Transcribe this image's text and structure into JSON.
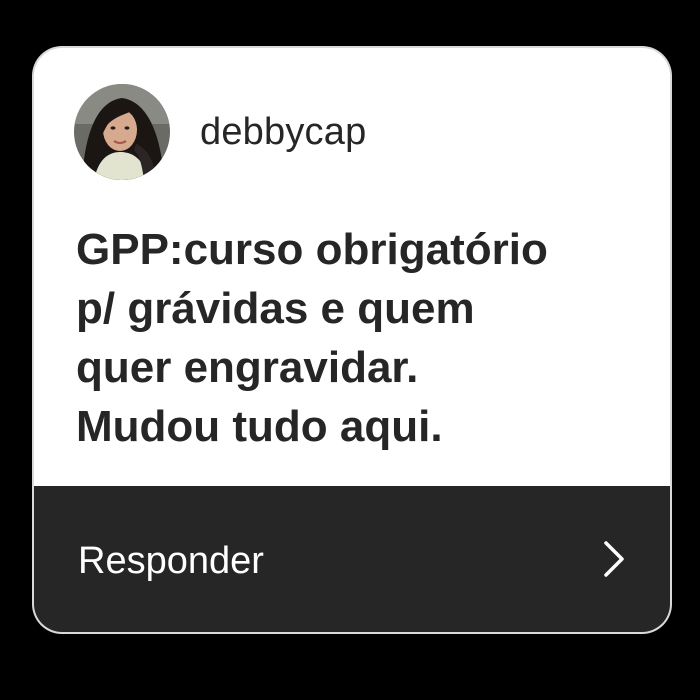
{
  "post": {
    "username": "debbycap",
    "message": "GPP:curso obrigatório\np/ grávidas e quem\nquer engravidar.\nMudou tudo aqui."
  },
  "reply": {
    "label": "Responder",
    "icon": "chevron-right-icon"
  },
  "colors": {
    "background": "#000000",
    "card": "#ffffff",
    "text": "#262626",
    "footer": "#262626",
    "footer_text": "#ffffff"
  }
}
